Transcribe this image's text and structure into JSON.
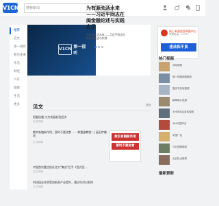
{
  "header": {
    "logo_text": "V1CN",
    "search_placeholder": "搜索新闻"
  },
  "leftnav": {
    "items": [
      {
        "label": "推荐",
        "active": true
      },
      {
        "label": "见文",
        "active": false
      },
      {
        "label": "第一视听",
        "active": false
      },
      {
        "label": "看见未来",
        "active": false
      },
      {
        "label": "乐活",
        "active": false
      },
      {
        "label": "财经",
        "active": false
      },
      {
        "label": "汽车",
        "active": false
      },
      {
        "label": "健康",
        "active": false
      },
      {
        "label": "生活",
        "active": false
      },
      {
        "label": "更多",
        "active": false
      }
    ]
  },
  "hero": {
    "brand_box": "V1CN",
    "brand_text": "第一视听",
    "title": "为有源头活水来——习近平同志在闽金融论述与实践启示",
    "subtitle": "为有源头活水来——习近平同志在闽金融论述与实践"
  },
  "ad": {
    "line1": "网上有害信息举报中心",
    "line2": "举报电话：12377",
    "button": "违法和不良"
  },
  "hot": {
    "title": "热门视频",
    "items": [
      {
        "text": "流动视频"
      },
      {
        "text": "国一带路视频新闻"
      },
      {
        "text": "国庆节庆祝视频"
      },
      {
        "text": "新闻城乡发展"
      },
      {
        "text": "306年鸡毛宣传视频"
      },
      {
        "text": "306中国节日"
      },
      {
        "text": "中国广告"
      },
      {
        "text": "今日视频新闻"
      },
      {
        "text": "当日热点新闻"
      }
    ]
  },
  "latest": {
    "title": "最新更新"
  },
  "section": {
    "title": "见文",
    "more": "更多"
  },
  "news": {
    "items": [
      {
        "headline": "把握机遇 大力发展新型经济",
        "meta": "文/文明网"
      },
      {
        "headline": "数实有融新作用，暂时不要进食 ……和重量教程！| 延田传播站",
        "meta": "文/文明网"
      },
      {
        "headline": "",
        "meta": ""
      },
      {
        "headline": "中国首次重点担任北方\"集合\"后手《西方宣…",
        "meta": "文/文明网"
      },
      {
        "headline": "科技园去年承受创新多产业提升，通过年对以前的",
        "meta": "文/文明网"
      }
    ],
    "image_title": "数实有融新作用",
    "image_subtitle": "暂时不要进食"
  },
  "colors": {
    "accent": "#1a66d6",
    "dark_banner": "#0c2e55",
    "red": "#d9361d",
    "nav_text": "#888888"
  }
}
